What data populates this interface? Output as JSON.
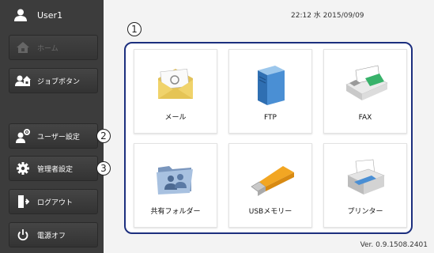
{
  "sidebar": {
    "user": "User1",
    "buttons": [
      {
        "label": "ホーム",
        "icon": "home-icon",
        "disabled": true
      },
      {
        "label": "ジョブボタン",
        "icon": "job-button-icon",
        "disabled": false
      },
      {
        "label": "ユーザー設定",
        "icon": "user-settings-icon",
        "disabled": false
      },
      {
        "label": "管理者設定",
        "icon": "gear-icon",
        "disabled": false
      },
      {
        "label": "ログアウト",
        "icon": "logout-icon",
        "disabled": false
      },
      {
        "label": "電源オフ",
        "icon": "power-icon",
        "disabled": false
      }
    ]
  },
  "header": {
    "datetime": "22:12 水 2015/09/09"
  },
  "markers": [
    "1",
    "2",
    "3"
  ],
  "tiles": [
    {
      "label": "メール",
      "icon": "mail-icon"
    },
    {
      "label": "FTP",
      "icon": "ftp-server-icon"
    },
    {
      "label": "FAX",
      "icon": "fax-icon"
    },
    {
      "label": "共有フォルダー",
      "icon": "shared-folder-icon"
    },
    {
      "label": "USBメモリー",
      "icon": "usb-memory-icon"
    },
    {
      "label": "プリンター",
      "icon": "printer-icon"
    }
  ],
  "footer": {
    "version": "Ver. 0.9.1508.2401"
  },
  "colors": {
    "sidebar": "#3c3c3c",
    "panel_border": "#1c2f7e",
    "background": "#f3f3f3"
  }
}
